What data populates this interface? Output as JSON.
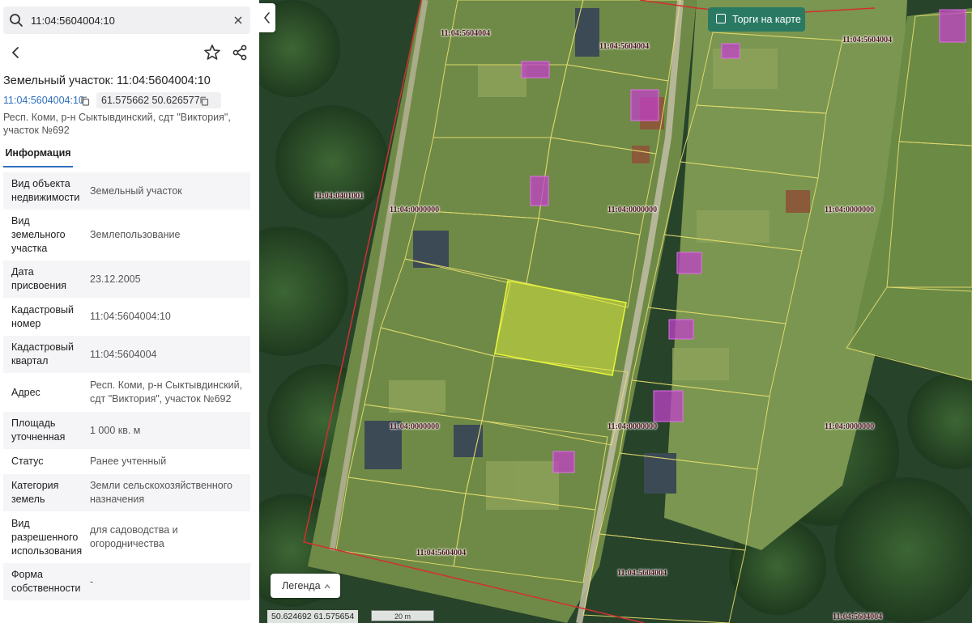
{
  "search": {
    "value": "11:04:5604004:10"
  },
  "header": {
    "title": "Земельный участок: 11:04:5604004:10",
    "cad_number": "11:04:5604004:10",
    "coords": "61.575662 50.626577",
    "address": "Респ. Коми, р-н Сыктывдинский, сдт \"Виктория\", участок №692"
  },
  "tabs": [
    {
      "label": "Информация",
      "active": true
    }
  ],
  "props": [
    {
      "key": "Вид объекта недвижимости",
      "value": "Земельный участок"
    },
    {
      "key": "Вид земельного участка",
      "value": "Землепользование"
    },
    {
      "key": "Дата присвоения",
      "value": "23.12.2005"
    },
    {
      "key": "Кадастровый номер",
      "value": "11:04:5604004:10"
    },
    {
      "key": "Кадастровый квартал",
      "value": "11:04:5604004"
    },
    {
      "key": "Адрес",
      "value": "Респ. Коми, р-н Сыктывдинский, сдт \"Виктория\",  участок №692"
    },
    {
      "key": "Площадь уточненная",
      "value": "1 000 кв. м"
    },
    {
      "key": "Статус",
      "value": "Ранее учтенный"
    },
    {
      "key": "Категория земель",
      "value": "Земли сельскохозяйственного назначения"
    },
    {
      "key": "Вид разрешенного использования",
      "value": "для садоводства и огородничества"
    },
    {
      "key": "Форма собственности",
      "value": "-"
    }
  ],
  "map": {
    "torgi_label": "Торги на карте",
    "legend_label": "Легенда",
    "cursor_coords": "50.624692   61.575654",
    "scale_label": "20 m",
    "labels": [
      "11:04:5604004",
      "11:04:5604004",
      "11:04:5604004",
      "11:04:0401001",
      "11:04:0000000",
      "11:04:0000000",
      "11:04:0000000",
      "11:04:0000000",
      "11:04:0000000",
      "11:04:0000000",
      "11:04:5604004",
      "11:04:5604004",
      "11:04:5604004"
    ]
  },
  "colors": {
    "accent": "#2f6fbd",
    "torgi_bg": "#2a7a63",
    "selected_parcel": "#e6f53a",
    "parcel_border": "#e8e070",
    "boundary": "#d23030",
    "building_marker": "#c040c8"
  }
}
